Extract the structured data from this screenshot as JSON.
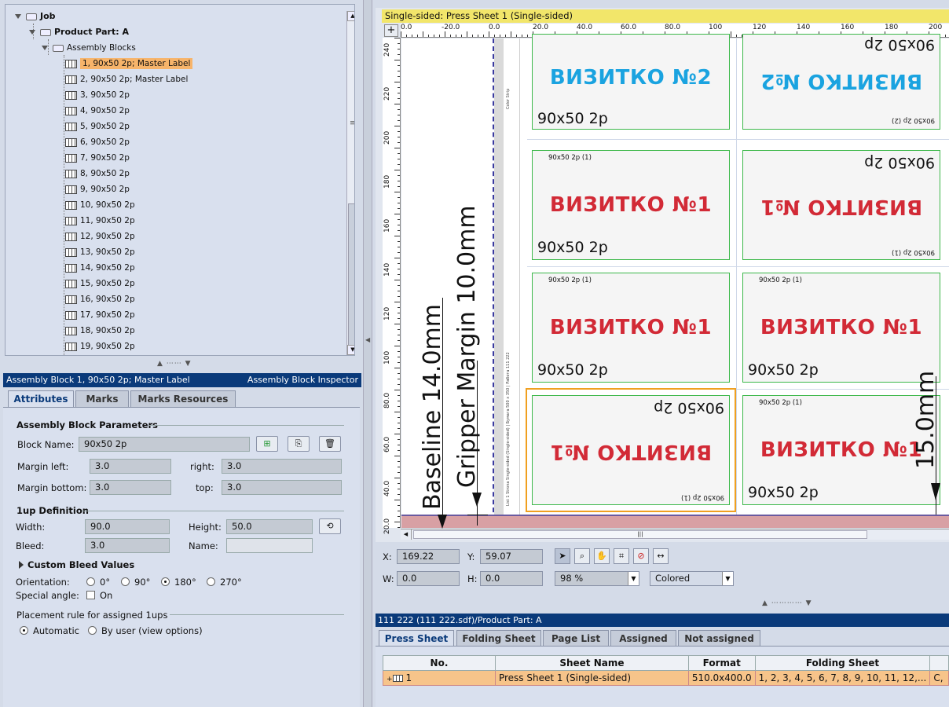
{
  "tree": {
    "root": "Job",
    "product_part": "Product Part: A",
    "assembly_blocks": "Assembly Blocks",
    "items": [
      "1, 90x50 2p; Master Label",
      "2, 90x50 2p; Master Label",
      "3, 90x50 2p",
      "4, 90x50 2p",
      "5, 90x50 2p",
      "6, 90x50 2p",
      "7, 90x50 2p",
      "8, 90x50 2p",
      "9, 90x50 2p",
      "10, 90x50 2p",
      "11, 90x50 2p",
      "12, 90x50 2p",
      "13, 90x50 2p",
      "14, 90x50 2p",
      "15, 90x50 2p",
      "16, 90x50 2p",
      "17, 90x50 2p",
      "18, 90x50 2p",
      "19, 90x50 2p"
    ]
  },
  "inspector": {
    "header_left": "Assembly Block 1, 90x50 2p; Master Label",
    "header_right": "Assembly Block Inspector",
    "tabs": [
      "Attributes",
      "Marks",
      "Marks Resources"
    ],
    "params_title": "Assembly Block Parameters",
    "block_name_label": "Block Name:",
    "block_name": "90x50 2p",
    "margin_left_label": "Margin left:",
    "margin_left": "3.0",
    "right_label": "right:",
    "margin_right": "3.0",
    "margin_bottom_label": "Margin bottom:",
    "margin_bottom": "3.0",
    "top_label": "top:",
    "margin_top": "3.0",
    "oneup_title": "1up Definition",
    "width_label": "Width:",
    "width": "90.0",
    "height_label": "Height:",
    "height": "50.0",
    "bleed_label": "Bleed:",
    "bleed": "3.0",
    "name_label": "Name:",
    "name": "",
    "custom_bleed": "Custom Bleed Values",
    "orientation_label": "Orientation:",
    "orientations": [
      "0°",
      "90°",
      "180°",
      "270°"
    ],
    "orientation_selected": "180°",
    "special_angle_label": "Special angle:",
    "special_on": "On",
    "placement_title": "Placement rule for assigned 1ups",
    "placement_auto": "Automatic",
    "placement_user": "By user (view options)"
  },
  "canvas": {
    "sheet_title": "Single-sided:  Press Sheet 1 (Single-sided)",
    "hruler_ticks": [
      "0.0",
      "-20.0",
      "0.0",
      "20.0",
      "40.0",
      "60.0",
      "80.0",
      "100",
      "120",
      "140",
      "160",
      "180",
      "200"
    ],
    "vruler_ticks": [
      "240",
      "220",
      "200",
      "180",
      "160",
      "140",
      "120",
      "100",
      "80.0",
      "60.0",
      "40.0",
      "20.0"
    ],
    "baseline_text": "Baseline 14.0mm",
    "gripper_text": "Gripper Margin 10.0mm",
    "right_dim": "15.0mm",
    "color_strip": "Color Strip",
    "slug_line": "List 1 Strona Single-sided (Single-sided) | Бумага 500 x 350 | Работа 111 222",
    "card_v2": "ВИЗИТКО №2",
    "card_v1": "ВИЗИТКО №1",
    "card_size": "90x50 2p",
    "card_small_1": "90x50 2p (1)",
    "card_small_2": "90x50 2p (2)",
    "x_label": "X:",
    "x_value": "169.22",
    "y_label": "Y:",
    "y_value": "59.07",
    "w_label": "W:",
    "w_value": "0.0",
    "h_label": "H:",
    "h_value": "0.0",
    "zoom": "98 %",
    "view_mode": "Colored"
  },
  "sheet_list": {
    "header": "111 222  (111 222.sdf)/Product Part: A",
    "tabs": [
      "Press Sheet",
      "Folding Sheet",
      "Page List",
      "Assigned",
      "Not assigned"
    ],
    "columns": [
      "No.",
      "Sheet Name",
      "Format",
      "Folding Sheet",
      ""
    ],
    "rows": [
      {
        "no": "1",
        "name": "Press Sheet 1 (Single-sided)",
        "format": "510.0x400.0",
        "folding": "1, 2, 3, 4, 5, 6, 7, 8, 9, 10, 11, 12,...",
        "extra": "C,"
      }
    ]
  },
  "colors": {
    "selection": "#f7b46a",
    "header_blue": "#0a3a7a",
    "title_yellow": "#f2e66a",
    "card_blue": "#1aa3e0",
    "card_red": "#d22a36",
    "trim_green": "#3cb84a"
  }
}
